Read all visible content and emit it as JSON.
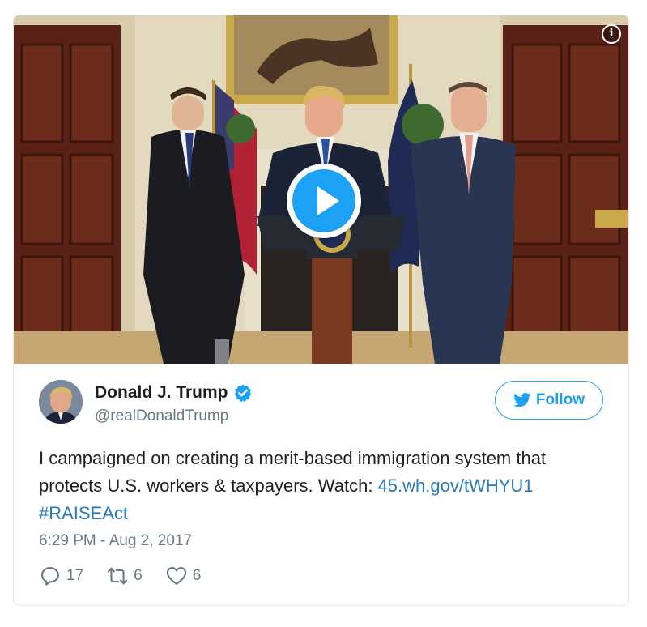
{
  "tweet": {
    "author_name": "Donald J. Trump",
    "author_handle": "@realDonaldTrump",
    "follow_label": "Follow",
    "text_prefix": "I campaigned on creating a merit-based immigration system that protects U.S. workers & taxpayers. Watch: ",
    "link_text": "45.wh.gov/tWHYU1",
    "hashtag": "#RAISEAct",
    "timestamp": "6:29 PM - Aug 2, 2017",
    "replies": "17",
    "retweets": "6",
    "likes": "6"
  },
  "media": {
    "type": "video",
    "info_icon": "info-icon",
    "play_icon": "play-icon"
  },
  "icons": {
    "verified": "verified-badge-icon",
    "follow": "twitter-bird-icon",
    "reply": "reply-icon",
    "retweet": "retweet-icon",
    "like": "heart-icon"
  },
  "colors": {
    "accent": "#1da1f2",
    "link": "#2b7bb9",
    "muted_text": "#697882",
    "text": "#1c2022"
  }
}
